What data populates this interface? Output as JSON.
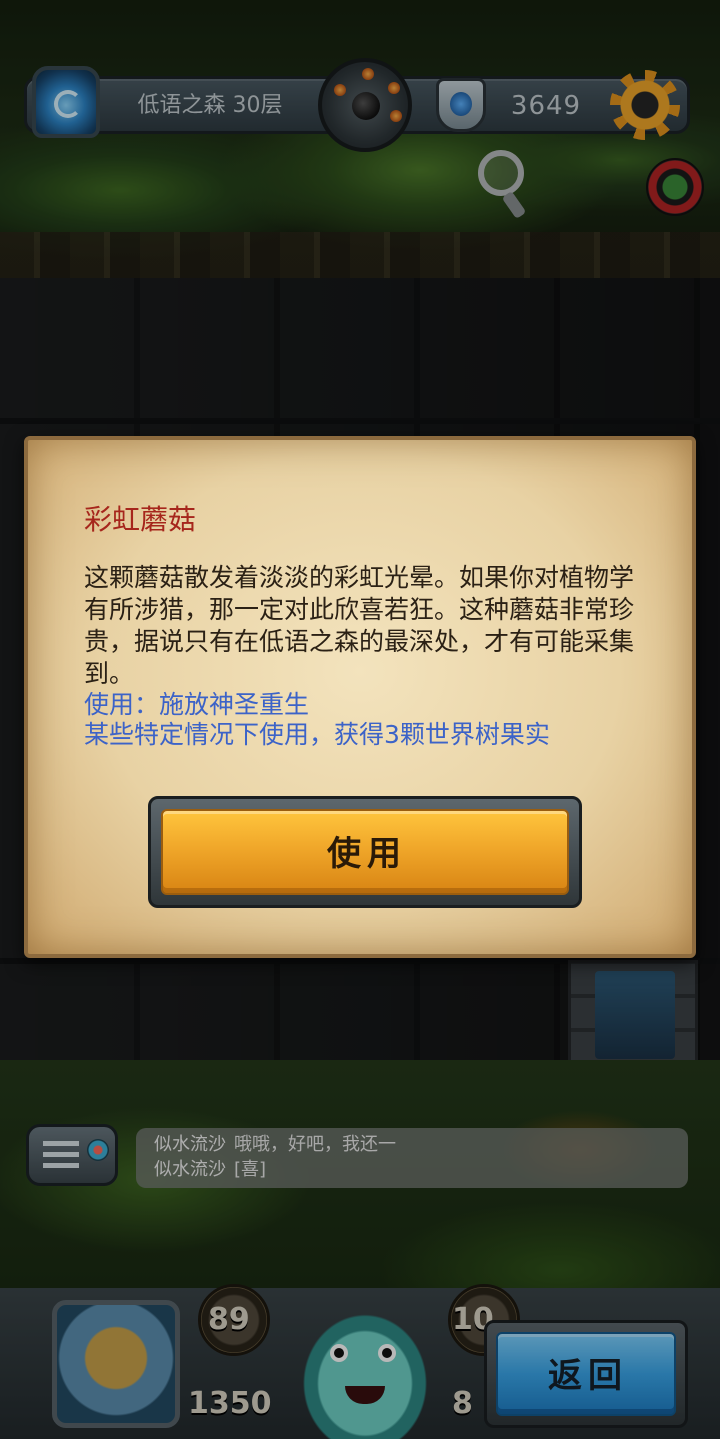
{
  "hud": {
    "floor_label": "低语之森 30层",
    "gold": "3649"
  },
  "dialog": {
    "title": "彩虹蘑菇",
    "description": "这颗蘑菇散发着淡淡的彩虹光晕。如果你对植物学有所涉猎，那一定对此欣喜若狂。这种蘑菇非常珍贵，据说只有在低语之森的最深处，才有可能采集到。",
    "usage_line1": "使用：施放神圣重生",
    "usage_line2": "某些特定情况下使用，获得3颗世界树果实",
    "use_button": "使用"
  },
  "chat": {
    "messages": [
      {
        "name": "似水流沙",
        "text": "哦哦，好吧，我还一"
      },
      {
        "name": "似水流沙",
        "text": "[喜]"
      }
    ]
  },
  "stats": {
    "attack": "89",
    "hp": "1350",
    "defense": "10",
    "extra": "8"
  },
  "back_button": "返回",
  "colors": {
    "title_red": "#a6261c",
    "usage_blue": "#3c63c8",
    "use_button_gold": "#f0a72a",
    "back_button_blue": "#3aa6ea"
  },
  "icons": [
    "portal-icon",
    "bomb-icon",
    "shield-icon",
    "gear-icon",
    "goblin-badge-icon",
    "magnifier-icon",
    "chat-menu-icon"
  ]
}
